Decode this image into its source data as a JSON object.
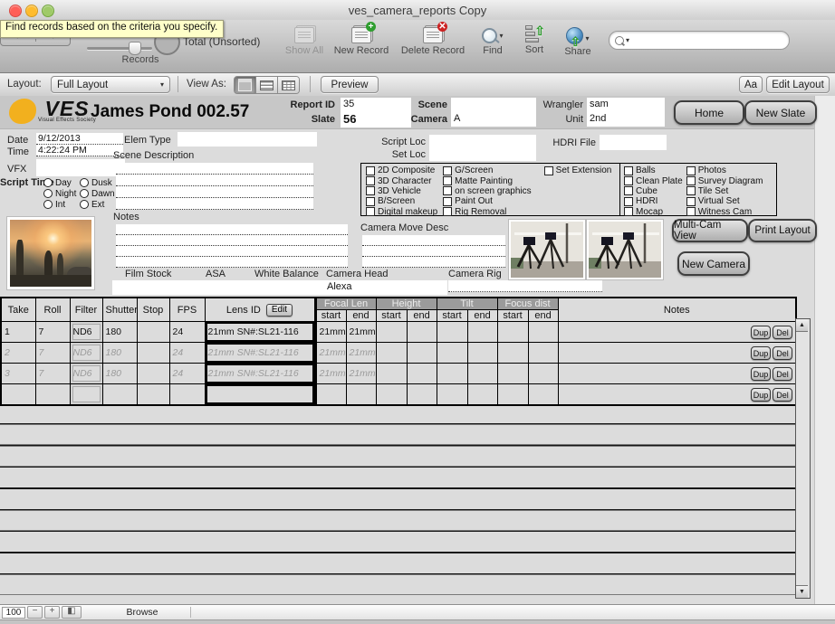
{
  "window": {
    "title": "ves_camera_reports Copy"
  },
  "tooltip": "Find records based on the criteria you specify.",
  "toolbar": {
    "records_label": "Records",
    "total_label": "Total (Unsorted)",
    "buttons": [
      {
        "label": "Show All",
        "disabled": true
      },
      {
        "label": "New Record"
      },
      {
        "label": "Delete Record"
      },
      {
        "label": "Find"
      },
      {
        "label": "Sort"
      },
      {
        "label": "Share"
      }
    ],
    "search": {
      "value": "",
      "placeholder": ""
    }
  },
  "layout_bar": {
    "layout_label": "Layout:",
    "layout_value": "Full Layout",
    "view_as_label": "View As:",
    "preview_label": "Preview",
    "text_size_label": "Aa",
    "edit_layout_label": "Edit Layout"
  },
  "header": {
    "logo": {
      "brand": "VES",
      "tagline": "Visual Effects Society"
    },
    "title": "James Pond 002.57",
    "fields": {
      "report_id": {
        "label": "Report ID",
        "value": "35"
      },
      "slate": {
        "label": "Slate",
        "value": "56"
      },
      "scene": {
        "label": "Scene",
        "value": ""
      },
      "camera": {
        "label": "Camera",
        "value": "A"
      },
      "wrangler": {
        "label": "Wrangler",
        "value": "sam"
      },
      "unit": {
        "label": "Unit",
        "value": "2nd"
      },
      "hdri_file": {
        "label": "HDRI File",
        "value": ""
      }
    },
    "buttons": {
      "home": "Home",
      "new_slate": "New Slate"
    }
  },
  "info": {
    "date": {
      "label": "Date",
      "value": "9/12/2013"
    },
    "time": {
      "label": "Time",
      "value": "4:22:24 PM"
    },
    "vfx": {
      "label": "VFX",
      "value": ""
    },
    "script_time": {
      "label": "Script Time",
      "options": [
        "Day",
        "Dusk",
        "Night",
        "Dawn",
        "Int",
        "Ext"
      ]
    },
    "elem_type": {
      "label": "Elem Type",
      "value": ""
    },
    "scene_description": {
      "label": "Scene Description",
      "value": ""
    },
    "script_loc": {
      "label": "Script Loc",
      "value": ""
    },
    "set_loc": {
      "label": "Set Loc",
      "value": ""
    },
    "notes_label": "Notes",
    "camera_move_desc_label": "Camera Move Desc",
    "film_stock": {
      "label": "Film Stock",
      "value": ""
    },
    "asa": {
      "label": "ASA",
      "value": ""
    },
    "white_balance": {
      "label": "White Balance",
      "value": ""
    },
    "camera_head": {
      "label": "Camera Head",
      "value": "Alexa"
    },
    "camera_rig": {
      "label": "Camera Rig",
      "value": ""
    }
  },
  "vfx_checkboxes": {
    "col1": [
      "2D Composite",
      "3D Character",
      "3D Vehicle",
      "B/Screen",
      "Digital makeup"
    ],
    "col2": [
      "G/Screen",
      "Matte Painting",
      "on screen graphics",
      "Paint Out",
      "Rig Removal"
    ],
    "col3": [
      "Set Extension"
    ]
  },
  "data_checkboxes": {
    "col1": [
      "Balls",
      "Clean Plate",
      "Cube",
      "HDRI",
      "Mocap"
    ],
    "col2": [
      "Photos",
      "Survey Diagram",
      "Tile Set",
      "Virtual Set",
      "Witness Cam"
    ]
  },
  "action_buttons": {
    "multi_cam": "Multi-Cam View",
    "print_layout": "Print Layout",
    "new_camera": "New Camera"
  },
  "takes_table": {
    "columns": [
      "Take",
      "Roll",
      "Filter",
      "Shutter",
      "Stop",
      "FPS",
      "Lens ID"
    ],
    "edit_button": "Edit",
    "groups": [
      {
        "label": "Focal Len",
        "sub": [
          "start",
          "end"
        ]
      },
      {
        "label": "Height",
        "sub": [
          "start",
          "end"
        ]
      },
      {
        "label": "Tilt",
        "sub": [
          "start",
          "end"
        ]
      },
      {
        "label": "Focus dist",
        "sub": [
          "start",
          "end"
        ]
      }
    ],
    "notes_header": "Notes",
    "row_buttons": {
      "dup": "Dup",
      "del": "Del"
    },
    "rows": [
      {
        "take": "1",
        "roll": "7",
        "filter": "ND6",
        "shutter": "180",
        "stop": "",
        "fps": "24",
        "lens_id": "21mm SN#:SL21-116",
        "fl_start": "21mm",
        "fl_end": "21mm",
        "h_start": "",
        "h_end": "",
        "t_start": "",
        "t_end": "",
        "fd_start": "",
        "fd_end": "",
        "notes": "",
        "ghost": false
      },
      {
        "take": "2",
        "roll": "7",
        "filter": "ND6",
        "shutter": "180",
        "stop": "",
        "fps": "24",
        "lens_id": "21mm SN#:SL21-116",
        "fl_start": "21mm",
        "fl_end": "21mm",
        "h_start": "",
        "h_end": "",
        "t_start": "",
        "t_end": "",
        "fd_start": "",
        "fd_end": "",
        "notes": "",
        "ghost": true
      },
      {
        "take": "3",
        "roll": "7",
        "filter": "ND6",
        "shutter": "180",
        "stop": "",
        "fps": "24",
        "lens_id": "21mm SN#:SL21-116",
        "fl_start": "21mm",
        "fl_end": "21mm",
        "h_start": "",
        "h_end": "",
        "t_start": "",
        "t_end": "",
        "fd_start": "",
        "fd_end": "",
        "notes": "",
        "ghost": true
      },
      {
        "take": "",
        "roll": "",
        "filter": "",
        "shutter": "",
        "stop": "",
        "fps": "",
        "lens_id": "",
        "fl_start": "",
        "fl_end": "",
        "h_start": "",
        "h_end": "",
        "t_start": "",
        "t_end": "",
        "fd_start": "",
        "fd_end": "",
        "notes": "",
        "ghost": false
      }
    ]
  },
  "status_bar": {
    "zoom_level": "100",
    "mode": "Browse"
  },
  "colors": {
    "logo_yellow": "#f2b01e",
    "tooltip_bg": "#ffffc9",
    "new_record_green": "#2f9e2f",
    "delete_red": "#cc2222",
    "share_blue": "#4d8fc4",
    "group_header_gray": "#9b9b9b"
  }
}
